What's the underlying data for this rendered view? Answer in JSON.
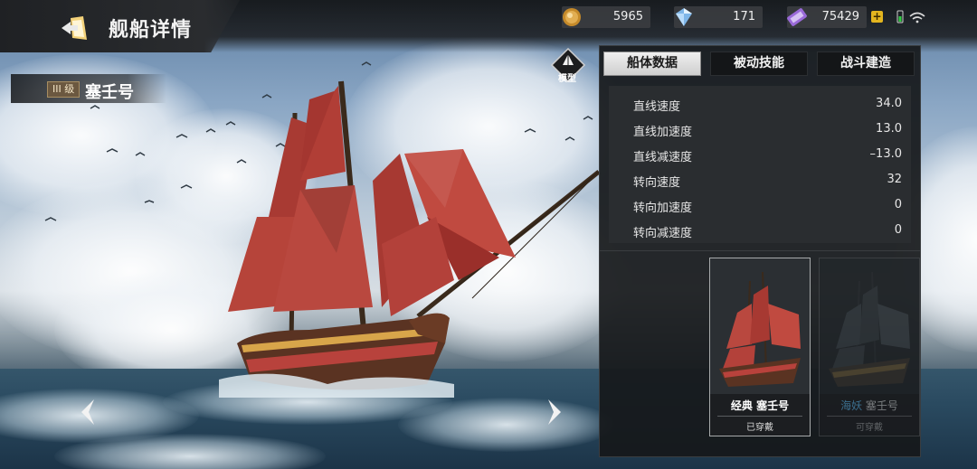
{
  "header": {
    "title": "舰船详情",
    "back_icon": "back-arrow-icon"
  },
  "resources": [
    {
      "name": "gold",
      "icon": "gold-coin-icon",
      "value": "5965"
    },
    {
      "name": "diamond",
      "icon": "diamond-icon",
      "value": "171"
    },
    {
      "name": "ticket",
      "icon": "purple-ticket-icon",
      "value": "75429",
      "has_plus": true
    }
  ],
  "status_icons": [
    "battery-icon",
    "wifi-icon"
  ],
  "ship": {
    "tier": "III 级",
    "name": "塞壬号"
  },
  "model_button": {
    "label": "模型"
  },
  "tabs": [
    {
      "label": "船体数据",
      "active": true
    },
    {
      "label": "被动技能",
      "active": false
    },
    {
      "label": "战斗建造",
      "active": false
    }
  ],
  "stats": [
    {
      "label": "直线速度",
      "value": "34.0"
    },
    {
      "label": "直线加速度",
      "value": "13.0"
    },
    {
      "label": "直线减速度",
      "value": "–13.0"
    },
    {
      "label": "转向速度",
      "value": "32"
    },
    {
      "label": "转向加速度",
      "value": "0"
    },
    {
      "label": "转向减速度",
      "value": "0"
    }
  ],
  "skins": [
    {
      "prefix": "经典",
      "name": "塞壬号",
      "status": "已穿戴",
      "selected": true
    },
    {
      "prefix": "海妖",
      "name": "塞壬号",
      "status": "可穿戴",
      "selected": false
    }
  ],
  "colors": {
    "accent_gold": "#e3b51f",
    "sail_red": "#a83a33",
    "skin_prefix_blue": "#53a4d6"
  }
}
